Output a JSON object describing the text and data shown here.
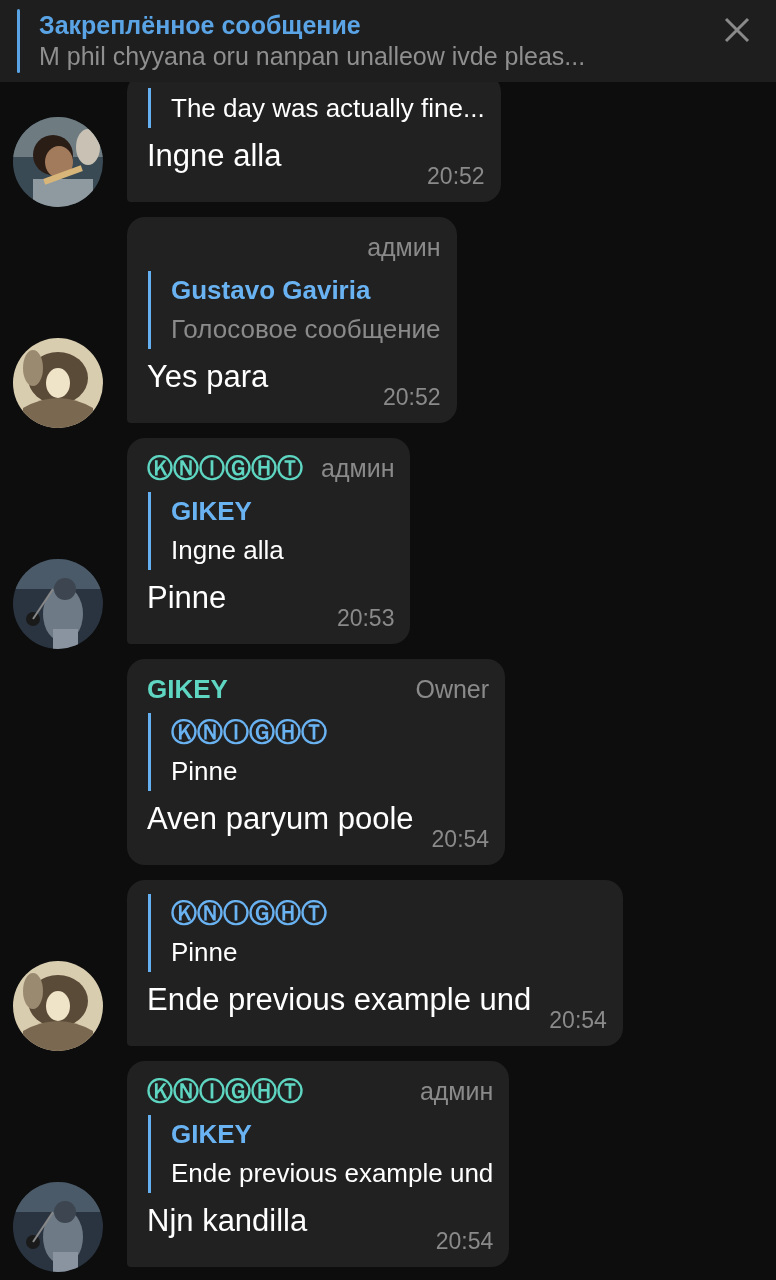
{
  "pinned": {
    "title": "Закреплённое сообщение",
    "text": "M phil chyyana oru nanpan unalleow ivde pleas..."
  },
  "messages": [
    {
      "quote": {
        "text": "The day was actually fine...",
        "muted": false
      },
      "text": "Ingne alla",
      "time": "20:52"
    },
    {
      "badge": "админ",
      "quote": {
        "author": "Gustavo Gaviria",
        "text": "Голосовое сообщение",
        "muted": true
      },
      "text": "Yes para",
      "time": "20:52"
    },
    {
      "sender": "ⓀⓃⒾⒼⒽⓉ",
      "badge": "админ",
      "quote": {
        "author": "GIKEY",
        "text": "Ingne alla",
        "muted": false
      },
      "text": "Pinne",
      "time": "20:53"
    },
    {
      "sender": "GIKEY",
      "badge": "Owner",
      "quote": {
        "author": "ⓀⓃⒾⒼⒽⓉ",
        "text": "Pinne",
        "muted": false
      },
      "text": "Aven paryum poole",
      "time": "20:54"
    },
    {
      "quote": {
        "author": "ⓀⓃⒾⒼⒽⓉ",
        "text": "Pinne",
        "muted": false
      },
      "text": "Ende previous example und",
      "time": "20:54"
    },
    {
      "sender": "ⓀⓃⒾⒼⒽⓉ",
      "badge": "админ",
      "quote": {
        "author": "GIKEY",
        "text": "Ende previous example und",
        "muted": false
      },
      "text": "Njn kandilla",
      "time": "20:54"
    }
  ]
}
